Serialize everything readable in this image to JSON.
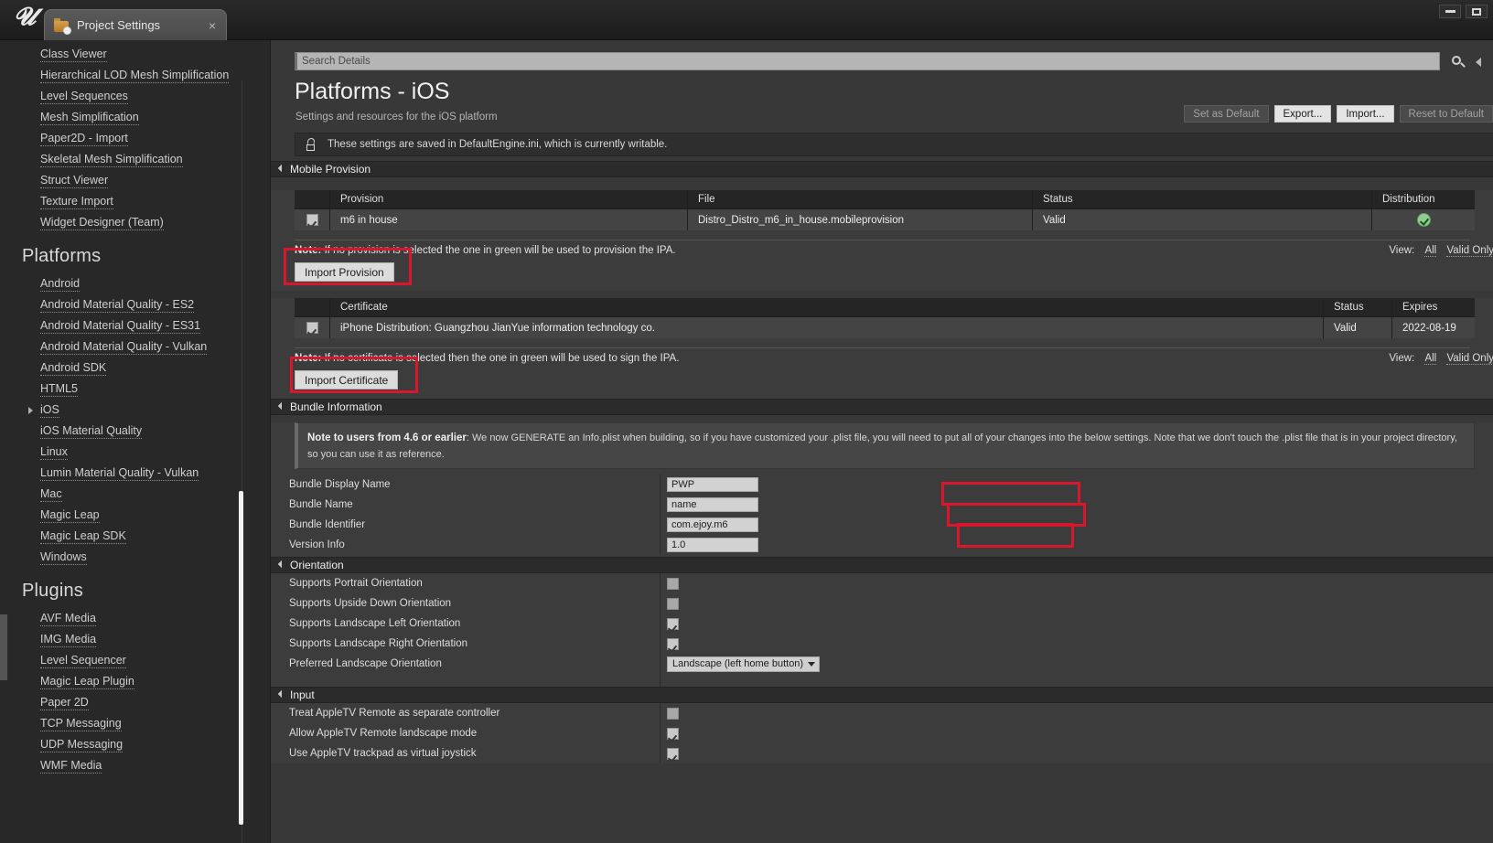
{
  "window": {
    "logo": "unreal-logo",
    "tab_label": "Project Settings",
    "tab_close": "×",
    "minimize": "minimize-icon",
    "maximize": "maximize-icon"
  },
  "search": {
    "placeholder": "Search Details",
    "value": ""
  },
  "header": {
    "title": "Platforms - iOS",
    "subtitle": "Settings and resources for the iOS platform",
    "buttons": [
      {
        "label": "Set as Default",
        "state": "disabled"
      },
      {
        "label": "Export...",
        "state": "enabled"
      },
      {
        "label": "Import...",
        "state": "enabled"
      },
      {
        "label": "Reset to Default",
        "state": "disabled"
      }
    ],
    "info_message": "These settings are saved in DefaultEngine.ini, which is currently writable."
  },
  "sidebar": {
    "top_items": [
      {
        "label": "Class Viewer"
      },
      {
        "label": "Hierarchical LOD Mesh Simplification"
      },
      {
        "label": "Level Sequences"
      },
      {
        "label": "Mesh Simplification"
      },
      {
        "label": "Paper2D - Import"
      },
      {
        "label": "Skeletal Mesh Simplification"
      },
      {
        "label": "Struct Viewer"
      },
      {
        "label": "Texture Import"
      },
      {
        "label": "Widget Designer (Team)"
      }
    ],
    "platforms_heading": "Platforms",
    "platform_items": [
      {
        "label": "Android",
        "expandable": false
      },
      {
        "label": "Android Material Quality - ES2",
        "expandable": false
      },
      {
        "label": "Android Material Quality - ES31",
        "expandable": false
      },
      {
        "label": "Android Material Quality - Vulkan",
        "expandable": false
      },
      {
        "label": "Android SDK",
        "expandable": false
      },
      {
        "label": "HTML5",
        "expandable": false
      },
      {
        "label": "iOS",
        "expandable": true
      },
      {
        "label": "iOS Material Quality",
        "expandable": false
      },
      {
        "label": "Linux",
        "expandable": false
      },
      {
        "label": "Lumin Material Quality - Vulkan",
        "expandable": false
      },
      {
        "label": "Mac",
        "expandable": false
      },
      {
        "label": "Magic Leap",
        "expandable": false
      },
      {
        "label": "Magic Leap SDK",
        "expandable": false
      },
      {
        "label": "Windows",
        "expandable": false
      }
    ],
    "plugins_heading": "Plugins",
    "plugin_items": [
      {
        "label": "AVF Media"
      },
      {
        "label": "IMG Media"
      },
      {
        "label": "Level Sequencer"
      },
      {
        "label": "Magic Leap Plugin"
      },
      {
        "label": "Paper 2D"
      },
      {
        "label": "TCP Messaging"
      },
      {
        "label": "UDP Messaging"
      },
      {
        "label": "WMF Media"
      }
    ]
  },
  "sections": {
    "mobile_provision": {
      "title": "Mobile Provision",
      "table_headers": [
        "",
        "Provision",
        "File",
        "Status",
        "Distribution"
      ],
      "row": {
        "checked": true,
        "provision": "m6 in house",
        "file": "Distro_Distro_m6_in_house.mobileprovision",
        "status": "Valid",
        "distribution": "valid-check-icon"
      },
      "note_bold": "Note:",
      "note_text": " If no provision is selected the one in green will be used to provision the IPA.",
      "view_label": "View:",
      "view_options": [
        "All",
        "Valid Only"
      ],
      "import_button": "Import Provision"
    },
    "certificate": {
      "table_headers": [
        "",
        "Certificate",
        "Status",
        "Expires"
      ],
      "row": {
        "checked": true,
        "certificate": "iPhone Distribution: Guangzhou JianYue information technology co.",
        "status": "Valid",
        "expires": "2022-08-19"
      },
      "note_bold": "Note:",
      "note_text": " If no certificate is selected then the one in green will be used to sign the IPA.",
      "view_label": "View:",
      "view_options": [
        "All",
        "Valid Only"
      ],
      "import_button": "Import Certificate"
    },
    "bundle_information": {
      "title": "Bundle Information",
      "note_bold": "Note to users from 4.6 or earlier",
      "note_text": ": We now GENERATE an Info.plist when building, so if you have customized your .plist file, you will need to put all of your changes into the below settings. Note that we don't touch the .plist file that is in your project directory, so you can use it as reference.",
      "fields": [
        {
          "label": "Bundle Display Name",
          "value": "PWP",
          "annotated": true
        },
        {
          "label": "Bundle Name",
          "value": "name",
          "annotated": true
        },
        {
          "label": "Bundle Identifier",
          "value": "com.ejoy.m6",
          "annotated": true
        },
        {
          "label": "Version Info",
          "value": "1.0",
          "annotated": false
        }
      ]
    },
    "orientation": {
      "title": "Orientation",
      "checks": [
        {
          "label": "Supports Portrait Orientation",
          "checked": false
        },
        {
          "label": "Supports Upside Down Orientation",
          "checked": false
        },
        {
          "label": "Supports Landscape Left Orientation",
          "checked": true
        },
        {
          "label": "Supports Landscape Right Orientation",
          "checked": true
        }
      ],
      "dropdown": {
        "label": "Preferred Landscape Orientation",
        "value": "Landscape (left home button)"
      }
    },
    "input": {
      "title": "Input",
      "checks": [
        {
          "label": "Treat AppleTV Remote as separate controller",
          "checked": false
        },
        {
          "label": "Allow AppleTV Remote landscape mode",
          "checked": true
        },
        {
          "label": "Use AppleTV trackpad as virtual joystick",
          "checked": true
        }
      ]
    }
  },
  "annotations": {
    "color": "#d8172f",
    "boxes": [
      "import-provision",
      "import-certificate",
      "bundle-display-name",
      "bundle-name",
      "bundle-identifier"
    ]
  }
}
